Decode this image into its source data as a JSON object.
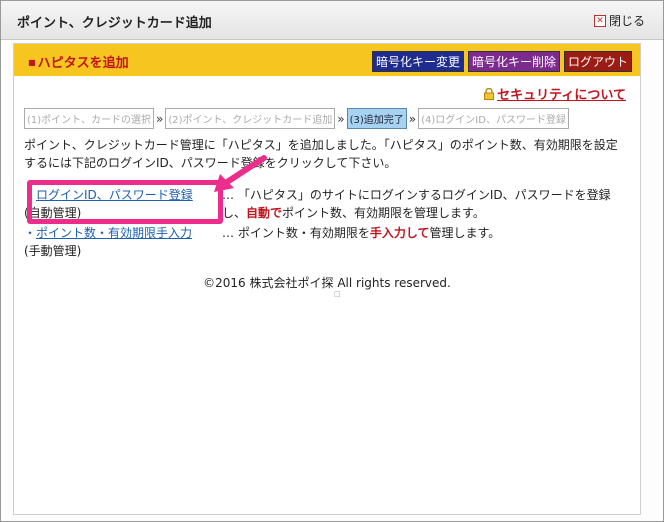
{
  "dialog": {
    "title": "ポイント、クレジットカード追加",
    "close_label": "閉じる"
  },
  "banner": {
    "title": "ハピタスを追加",
    "buttons": [
      {
        "label": "暗号化キー変更",
        "color": "#1f2c8f"
      },
      {
        "label": "暗号化キー削除",
        "color": "#7d2a8e"
      },
      {
        "label": "ログアウト",
        "color": "#9a1c14"
      }
    ]
  },
  "security_link": "セキュリティについて",
  "steps": [
    {
      "label": "(1)ポイント、カードの選択",
      "active": false
    },
    {
      "label": "(2)ポイント、クレジットカード追加",
      "active": false
    },
    {
      "label": "(3)追加完了",
      "active": true
    },
    {
      "label": "(4)ログインID、パスワード登録",
      "active": false
    }
  ],
  "step_separator": "»",
  "description": "ポイント、クレジットカード管理に「ハピタス」を追加しました。「ハピタス」のポイント数、有効期限を設定するには下記のログインID、パスワード登録をクリックして下さい。",
  "options": {
    "login": {
      "bullet": "・",
      "link": "ログインID、パスワード登録",
      "sub": "(自動管理)",
      "ellipsis": "…",
      "desc_1": "「ハピタス」のサイトにログインするログインID、パスワードを登録し、",
      "desc_bold": "自動で",
      "desc_2": "ポイント数、有効期限を管理します。"
    },
    "manual": {
      "bullet": "・",
      "link": "ポイント数・有効期限手入力",
      "sub": "(手動管理)",
      "ellipsis": "…",
      "desc_1": "ポイント数・有効期限を",
      "desc_bold": "手入力して",
      "desc_2": "管理します。"
    }
  },
  "footer": "©2016 株式会社ポイ探 All rights reserved.",
  "colors": {
    "banner": "#f7c520",
    "accent_red": "#c0151e",
    "link_blue": "#1a5fb4",
    "highlight_pink": "#ec2d8c",
    "active_step": "#a7d3f2"
  }
}
